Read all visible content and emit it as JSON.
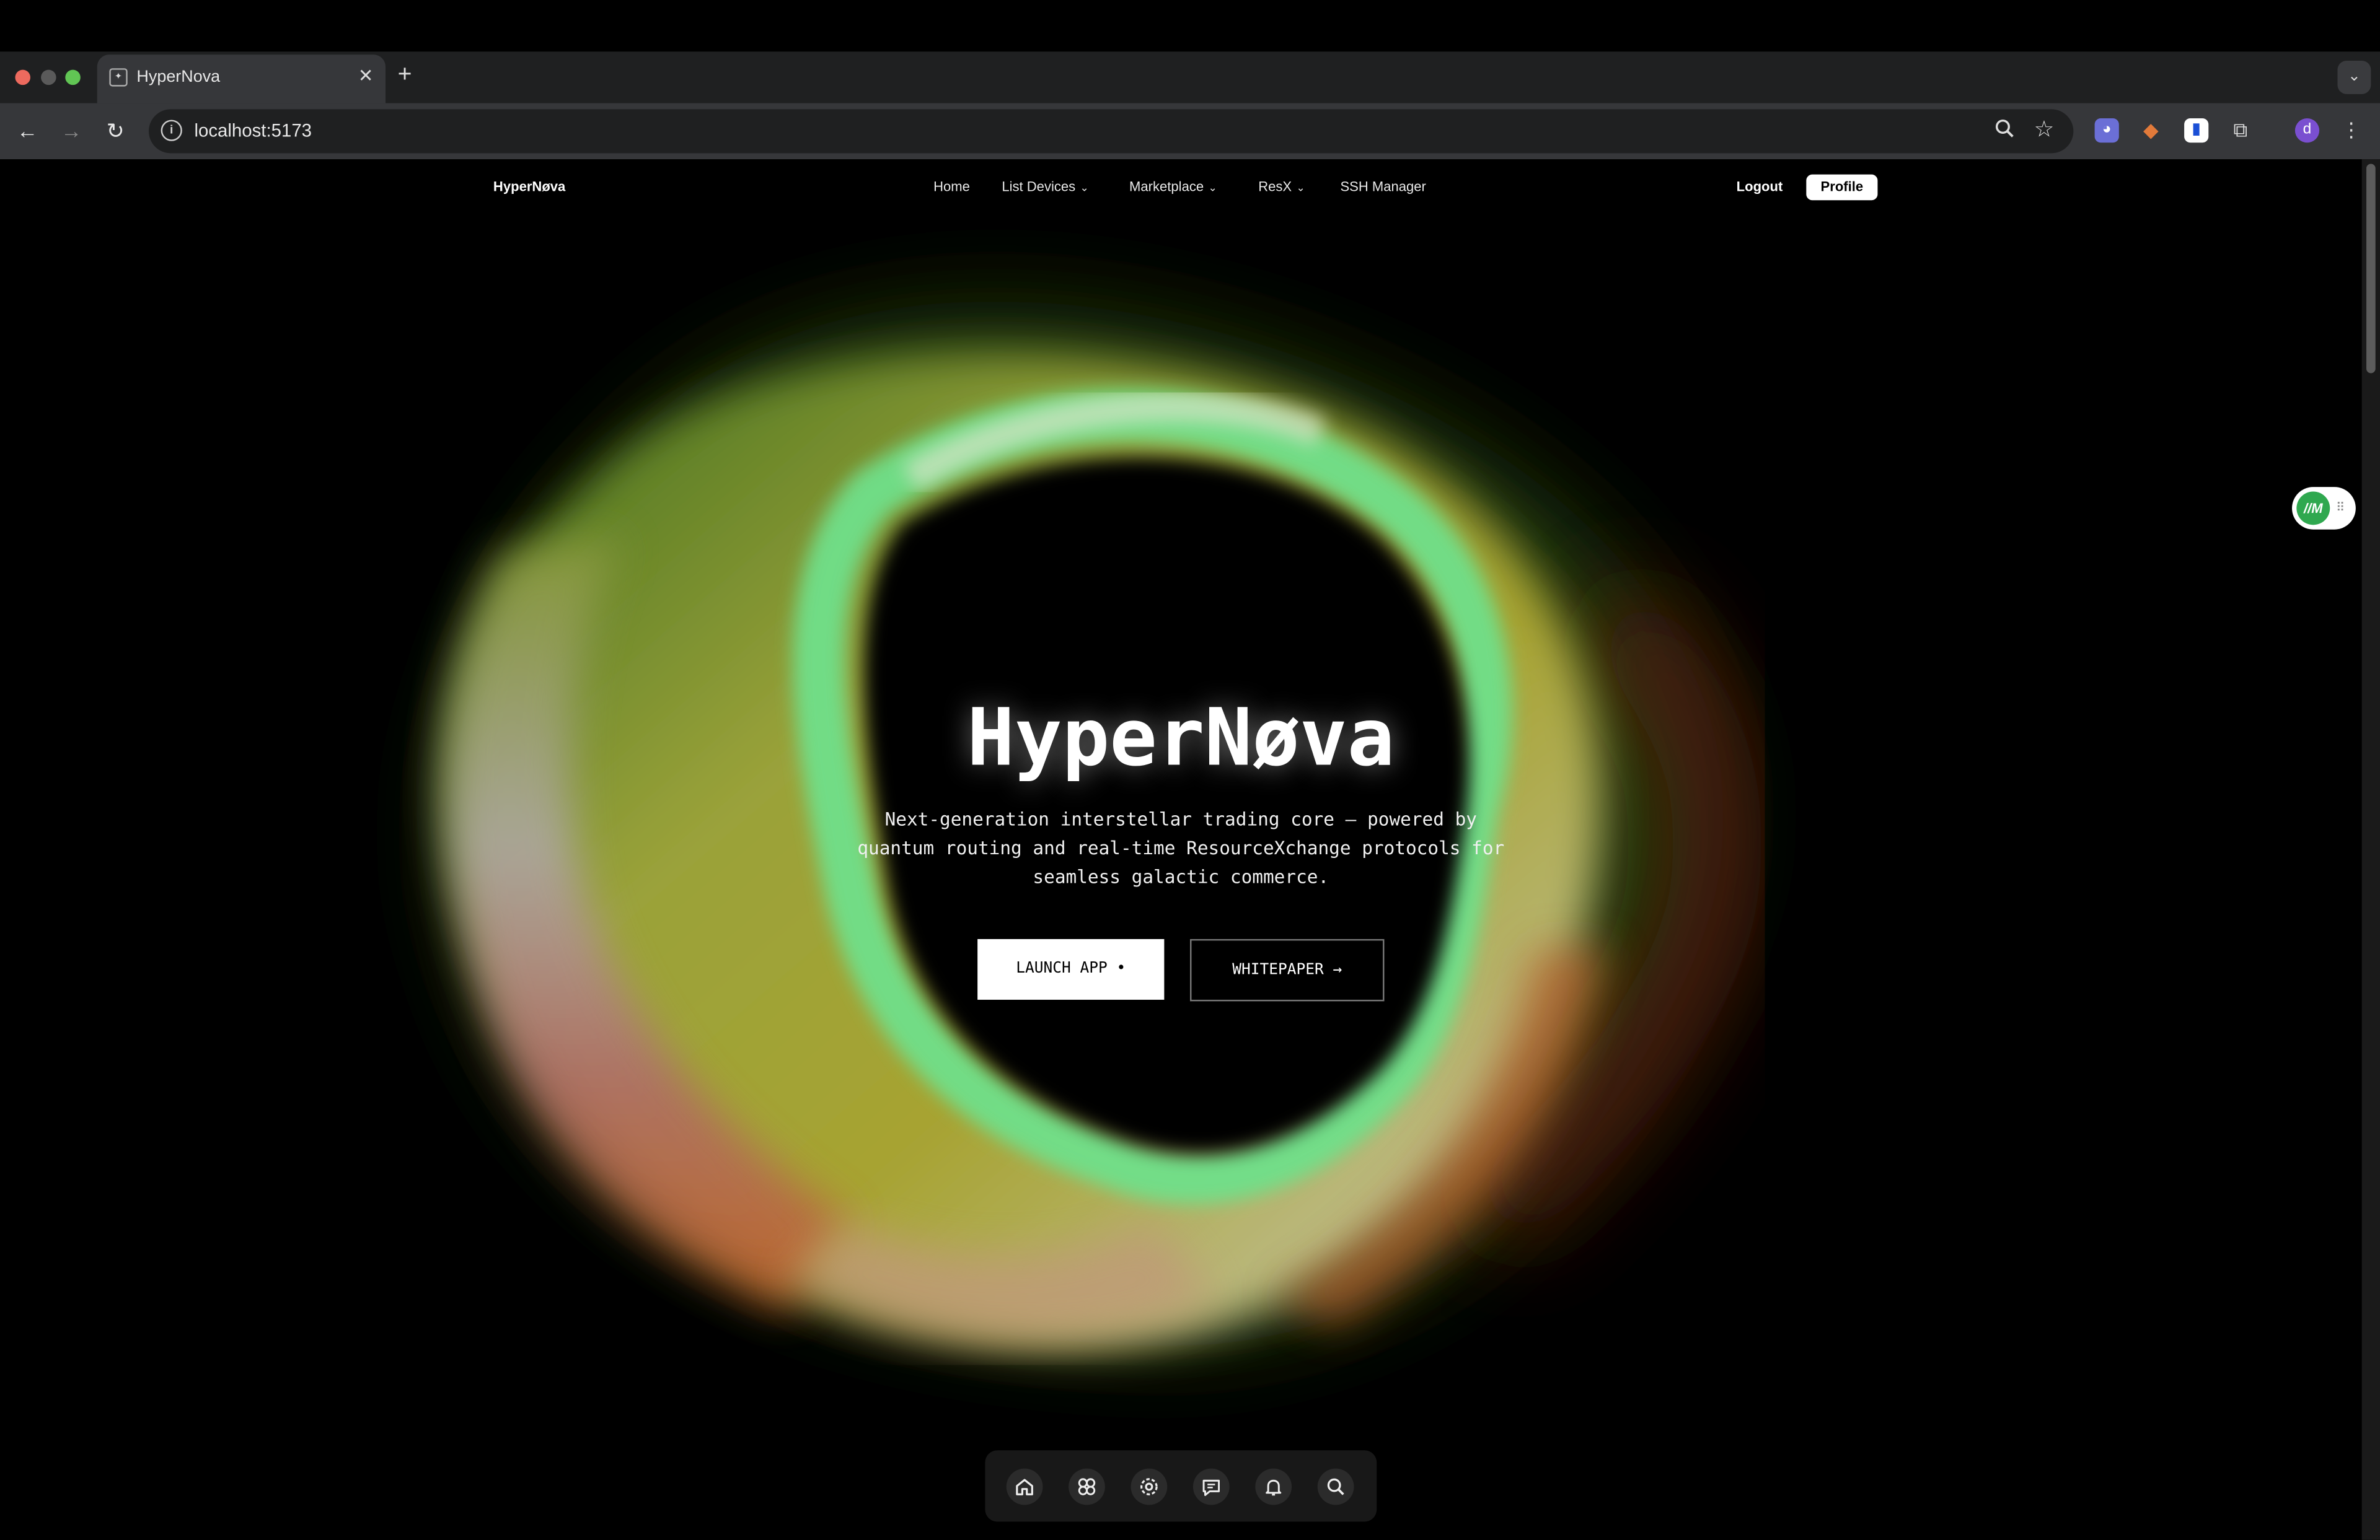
{
  "browser": {
    "tab_title": "HyperNova",
    "url": "localhost:5173",
    "avatar_letter": "d"
  },
  "nav": {
    "brand": "HyperNøva",
    "links": [
      {
        "label": "Home",
        "dropdown": false
      },
      {
        "label": "List Devices",
        "dropdown": true
      },
      {
        "label": "Marketplace",
        "dropdown": true
      },
      {
        "label": "ResX",
        "dropdown": true
      },
      {
        "label": "SSH Manager",
        "dropdown": false
      }
    ],
    "logout": "Logout",
    "profile": "Profile"
  },
  "hero": {
    "title": "HyperNøva",
    "subtitle": "Next-generation interstellar trading core — powered by quantum routing and real-time ResourceXchange protocols for seamless galactic commerce.",
    "launch_button": "LAUNCH APP •",
    "whitepaper_button": "WHITEPAPER →"
  },
  "dock": {
    "icons": [
      "home-icon",
      "apps-icon",
      "settings-icon",
      "chat-icon",
      "bell-icon",
      "search-icon"
    ]
  },
  "colors": {
    "accent_green": "#5ed27a",
    "accent_yellow": "#b8b832",
    "accent_orange": "#c0602a",
    "background": "#000000"
  }
}
